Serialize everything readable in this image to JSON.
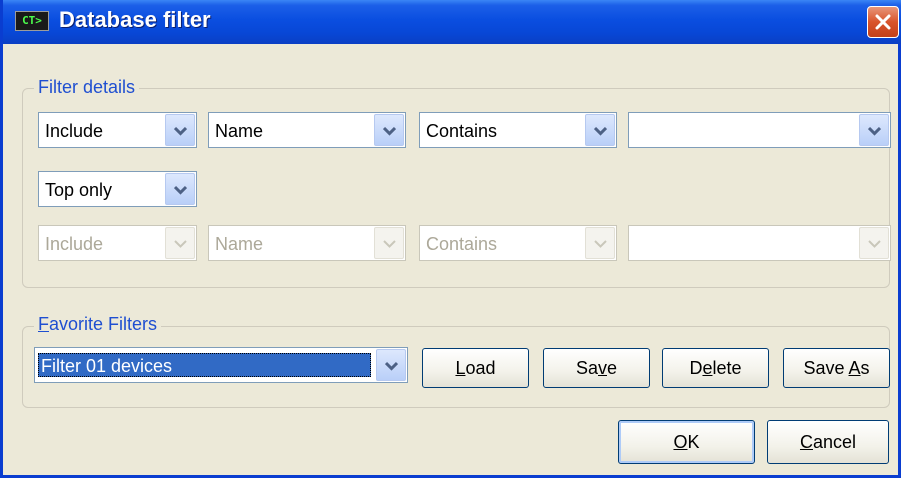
{
  "window": {
    "title": "Database filter",
    "icon": "CT>"
  },
  "filter_details": {
    "label": "Filter details",
    "row1": {
      "mode": "Include",
      "field": "Name",
      "operator": "Contains",
      "value": ""
    },
    "scope": "Top only",
    "row2": {
      "mode": "Include",
      "field": "Name",
      "operator": "Contains",
      "value": ""
    }
  },
  "favorites": {
    "label_prefix": "",
    "label_accel": "F",
    "label_rest": "avorite Filters",
    "selected": "Filter 01 devices",
    "load": {
      "a": "L",
      "b": "oad"
    },
    "save": {
      "a": "Sa",
      "b": "v",
      "c": "e"
    },
    "delete": {
      "a": "D",
      "b": "e",
      "c": "lete"
    },
    "save_as": {
      "a": "Save ",
      "b": "A",
      "c": "s"
    }
  },
  "buttons": {
    "ok": {
      "a": "O",
      "b": "K"
    },
    "cancel": {
      "a": "C",
      "b": "ancel"
    }
  }
}
